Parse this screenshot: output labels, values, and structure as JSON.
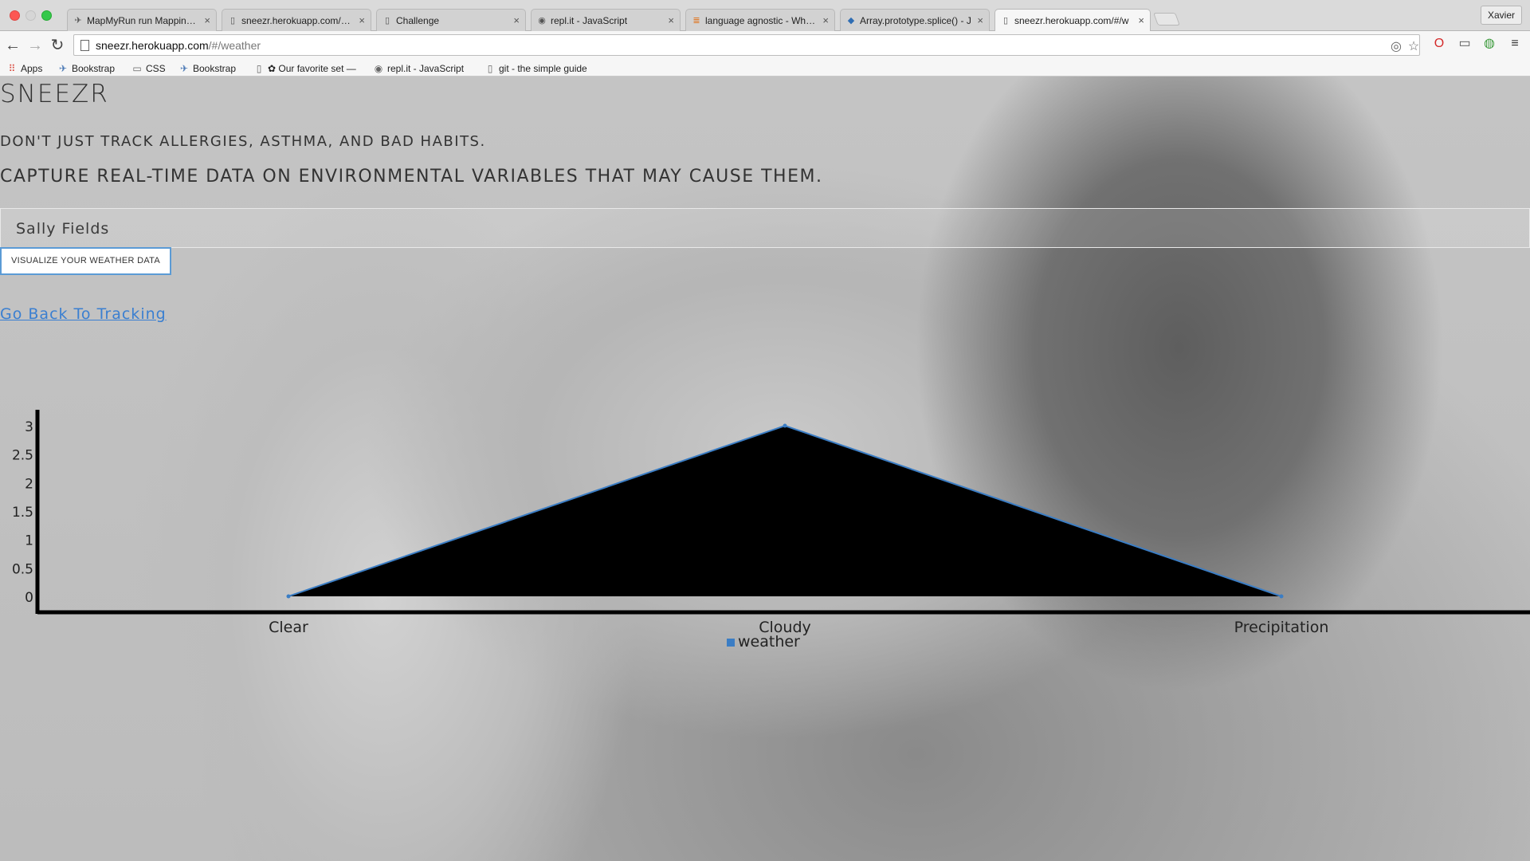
{
  "browser": {
    "tabs": [
      {
        "label": "MapMyRun run Mapping Ec",
        "icon": "mapmyrun-icon"
      },
      {
        "label": "sneezr.herokuapp.com/#/b",
        "icon": "page-icon"
      },
      {
        "label": "Challenge",
        "icon": "page-icon"
      },
      {
        "label": "repl.it - JavaScript",
        "icon": "replit-icon"
      },
      {
        "label": "language agnostic - What i",
        "icon": "stackoverflow-icon"
      },
      {
        "label": "Array.prototype.splice() - J",
        "icon": "mdn-icon"
      },
      {
        "label": "sneezr.herokuapp.com/#/w",
        "icon": "page-icon",
        "active": true
      }
    ],
    "profile": "Xavier",
    "url_host": "sneezr.herokuapp.com",
    "url_path": "/#/weather",
    "bookmarks": [
      {
        "label": "Apps",
        "icon": "apps-icon"
      },
      {
        "label": "Bookstrap",
        "icon": "bookstrap-icon"
      },
      {
        "label": "CSS",
        "icon": "folder-icon"
      },
      {
        "label": "Bookstrap",
        "icon": "bookstrap-icon"
      },
      {
        "label": "✿ Our favorite set —",
        "icon": "page-icon"
      },
      {
        "label": "repl.it - JavaScript",
        "icon": "replit-icon"
      },
      {
        "label": "git - the simple guide",
        "icon": "page-icon"
      }
    ]
  },
  "page": {
    "title": "SNEEZR",
    "tagline_1": "DON'T JUST TRACK ALLERGIES, ASTHMA, AND BAD HABITS.",
    "tagline_2": "CAPTURE REAL-TIME DATA ON ENVIRONMENTAL VARIABLES THAT MAY CAUSE THEM.",
    "user_name": "Sally Fields",
    "visualize_button": "VISUALIZE YOUR WEATHER DATA",
    "back_link": "Go Back To Tracking"
  },
  "colors": {
    "accent": "#5b9bd5",
    "link": "#3a7fd1",
    "area_fill": "#000000",
    "series_line": "#3b7dc4"
  },
  "chart_data": {
    "type": "area",
    "categories": [
      "Clear",
      "Cloudy",
      "Precipitation"
    ],
    "series": [
      {
        "name": "weather",
        "values": [
          0,
          3,
          0
        ]
      }
    ],
    "yticks": [
      "0",
      "0.5",
      "1",
      "1.5",
      "2",
      "2.5",
      "3"
    ],
    "ylim": [
      0,
      3
    ],
    "legend": "bottom-center",
    "grid": false
  }
}
